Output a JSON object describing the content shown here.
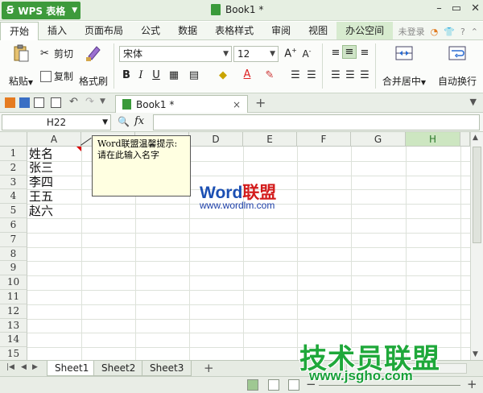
{
  "titlebar": {
    "app_name": "WPS 表格",
    "doc_title": "Book1 *"
  },
  "menu": {
    "tabs": [
      "开始",
      "插入",
      "页面布局",
      "公式",
      "数据",
      "表格样式",
      "审阅",
      "视图",
      "办公空间"
    ],
    "active": "开始",
    "login": "未登录"
  },
  "ribbon": {
    "paste": "粘贴",
    "cut": "剪切",
    "copy": "复制",
    "format_painter": "格式刷",
    "font_name": "宋体",
    "font_size": "12",
    "bold": "B",
    "italic": "I",
    "underline": "U",
    "merge_center": "合并居中",
    "wrap_text": "自动换行"
  },
  "doc_tab": {
    "label": "Book1 *"
  },
  "formula_bar": {
    "cell_ref": "H22",
    "fx": "fx",
    "content": ""
  },
  "grid": {
    "columns": [
      "A",
      "B",
      "C",
      "D",
      "E",
      "F",
      "G",
      "H"
    ],
    "selected_column": "H",
    "rows": [
      "1",
      "2",
      "3",
      "4",
      "5",
      "6",
      "7",
      "8",
      "9",
      "10",
      "11",
      "12",
      "13",
      "14",
      "15"
    ],
    "cells_a": [
      "姓名",
      "张三",
      "李四",
      "王五",
      "赵六"
    ]
  },
  "comment": {
    "line1": "Word联盟温馨提示:",
    "line2": "请在此输入名字"
  },
  "watermark": {
    "word": "Word",
    "lianmeng": "联盟",
    "url": "www.wordlm.com",
    "corner_title": "技术员联盟",
    "corner_url": "www.jsgho.com"
  },
  "sheets": {
    "tabs": [
      "Sheet1",
      "Sheet2",
      "Sheet3"
    ],
    "active": "Sheet1"
  },
  "colors": {
    "accent": "#3d9a3b",
    "selected_header": "#cde6c1",
    "comment_bg": "#ffffe1"
  }
}
